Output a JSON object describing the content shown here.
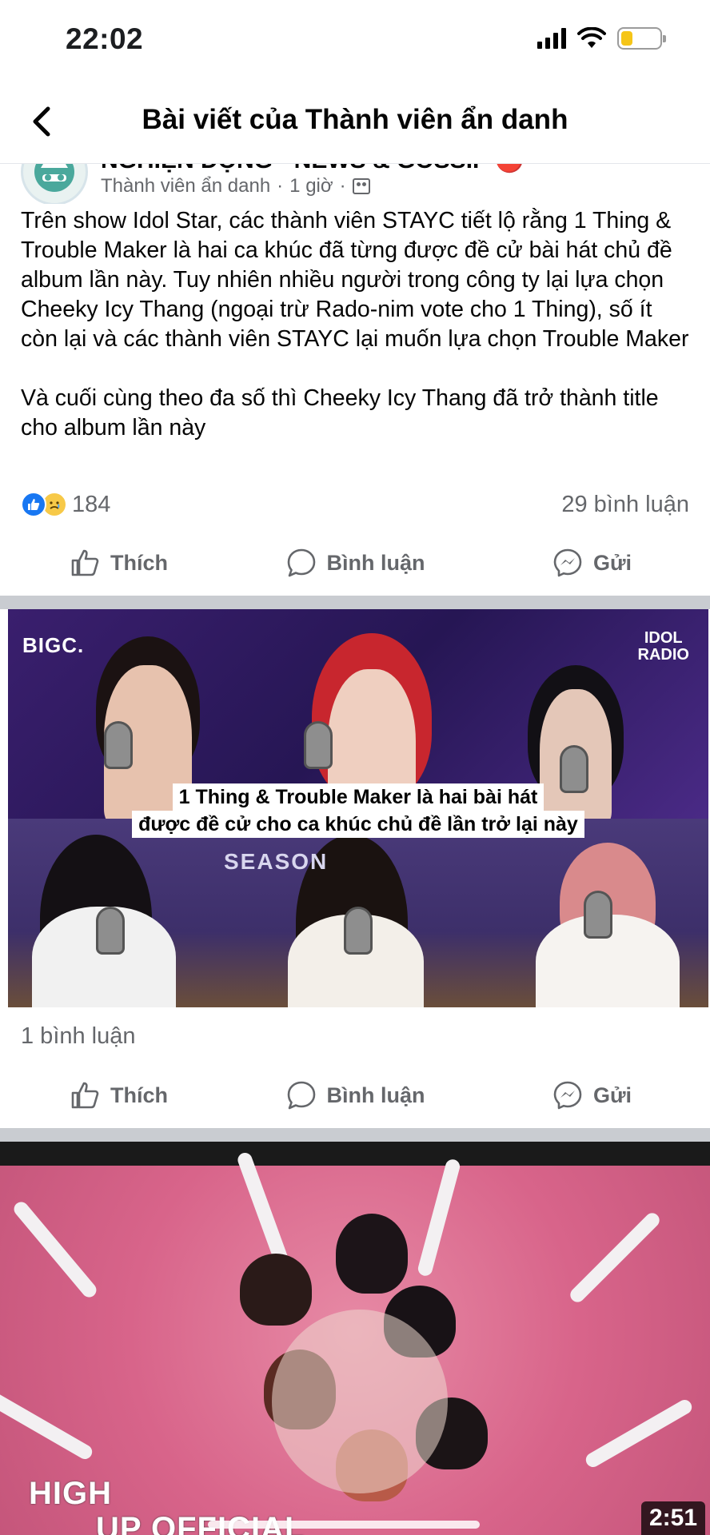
{
  "status_bar": {
    "time": "22:02",
    "battery_level": 0.3,
    "battery_color": "#f5c518"
  },
  "header": {
    "back_icon": "chevron-left-icon",
    "title": "Bài viết của Thành viên ẩn danh"
  },
  "post": {
    "group_name_partial": "NGHIỆN ĐỘNG · NEWS & GOSSIP 🔴",
    "author": "Thành viên ẩn danh",
    "time": "1 giờ",
    "audience_icon": "members-icon",
    "body": "Trên show Idol Star, các thành viên STAYC tiết lộ rằng 1 Thing & Trouble Maker là hai ca khúc đã từng được đề cử bài hát chủ đề album lần này. Tuy nhiên nhiều người trong công ty lại lựa chọn Cheeky Icy Thang (ngoại trừ Rado-nim vote cho 1 Thing), số ít còn lại và các thành viên STAYC lại muốn lựa chọn Trouble Maker\n\nVà cuối cùng theo đa số thì Cheeky Icy Thang đã trở thành title cho album lần này",
    "reaction_count": "184",
    "comment_count": "29 bình luận"
  },
  "actions": {
    "like": "Thích",
    "comment": "Bình luận",
    "send": "Gửi"
  },
  "media1": {
    "logo_left": "BIGC.",
    "logo_right_line1": "IDOL",
    "logo_right_line2": "RADIO",
    "subtitle_line1": "1 Thing & Trouble Maker là hai bài hát",
    "subtitle_line2": "được đề cử cho ca khúc chủ đề lần trở lại này",
    "background_text": "SEASON",
    "comment_count": "1 bình luận"
  },
  "media2": {
    "overlay_line1": "HIGH",
    "overlay_line2": "UP OFFICIAL",
    "duration": "2:51"
  },
  "colors": {
    "accent_blue": "#1877f2",
    "muted_text": "#65676b",
    "separator": "#c9ccd1"
  }
}
